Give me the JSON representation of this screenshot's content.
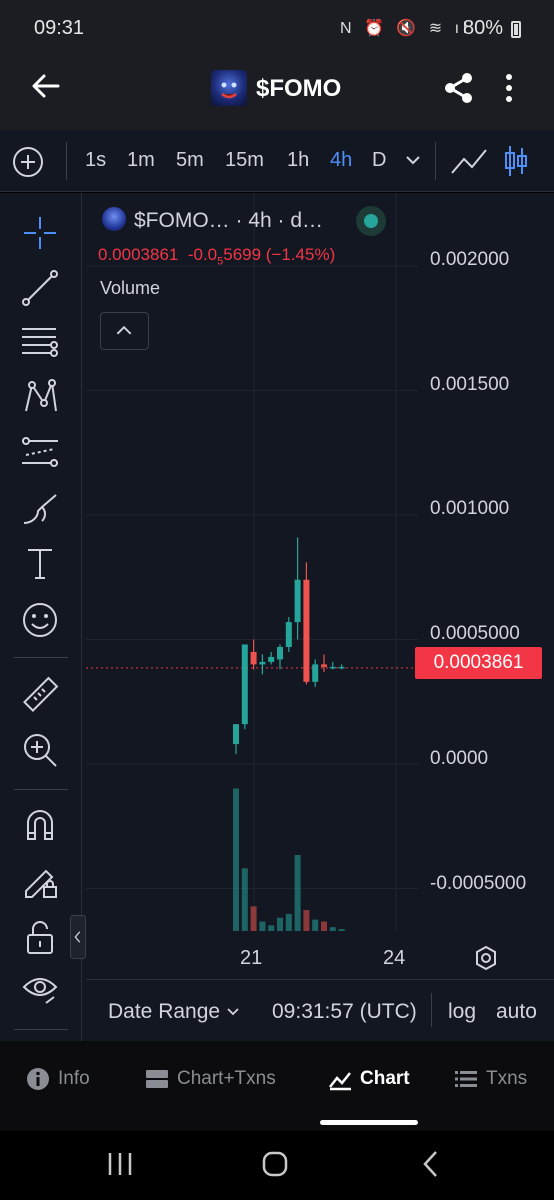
{
  "status_bar": {
    "time": "09:31",
    "icons": "N ⏰ 🔇 ≋ ıl",
    "battery": "80%"
  },
  "header": {
    "title": "$FOMO",
    "back_icon": "arrow-left-icon",
    "share_icon": "share-icon",
    "menu_icon": "more-vertical-icon"
  },
  "timeframes": {
    "items": [
      "1s",
      "1m",
      "5m",
      "15m",
      "1h",
      "4h",
      "D"
    ],
    "active": "4h"
  },
  "left_toolbar": {
    "tools": [
      "crosshair-icon",
      "trend-line-icon",
      "fib-retracement-icon",
      "pattern-icon",
      "prediction-icon",
      "brush-icon",
      "text-icon",
      "emoji-icon",
      "ruler-icon",
      "zoom-in-icon",
      "magnet-icon",
      "lock-drawing-icon",
      "unlock-icon",
      "eye-icon"
    ]
  },
  "legend": {
    "title": "$FOMO… · 4h · d…",
    "last": "0.0003861",
    "change_prefix": "-0.0",
    "change_sub": "5",
    "change_rest": "5699 (−1.45%)",
    "volume_label": "Volume"
  },
  "colors": {
    "up": "#26a69a",
    "down": "#ef5350",
    "accent": "#4e8ff8",
    "last_price_bg": "#f23645"
  },
  "chart_data": {
    "type": "candlestick",
    "price_axis_ticks": [
      "0.002000",
      "0.001500",
      "0.001000",
      "0.0005000",
      "0.0000",
      "-0.0005000"
    ],
    "x_tick_labels": [
      "21",
      "24"
    ],
    "last_price": "0.0003861",
    "ylim": [
      -0.0005,
      0.002
    ],
    "candles": [
      {
        "o": 8e-05,
        "h": 0.00016,
        "l": 4e-05,
        "c": 0.00016,
        "v": 0.75
      },
      {
        "o": 0.00016,
        "h": 0.00048,
        "l": 0.00014,
        "c": 0.00048,
        "v": 0.33
      },
      {
        "o": 0.00045,
        "h": 0.0005,
        "l": 0.00038,
        "c": 0.0004,
        "v": 0.13
      },
      {
        "o": 0.0004,
        "h": 0.00044,
        "l": 0.00036,
        "c": 0.00041,
        "v": 0.05
      },
      {
        "o": 0.00041,
        "h": 0.00045,
        "l": 0.0004,
        "c": 0.00043,
        "v": 0.03
      },
      {
        "o": 0.00042,
        "h": 0.00048,
        "l": 0.00038,
        "c": 0.00047,
        "v": 0.07
      },
      {
        "o": 0.00047,
        "h": 0.00059,
        "l": 0.00045,
        "c": 0.00057,
        "v": 0.09
      },
      {
        "o": 0.00057,
        "h": 0.00091,
        "l": 0.0005,
        "c": 0.00074,
        "v": 0.4
      },
      {
        "o": 0.00074,
        "h": 0.00081,
        "l": 0.00032,
        "c": 0.00033,
        "v": 0.11
      },
      {
        "o": 0.00033,
        "h": 0.00042,
        "l": 0.00031,
        "c": 0.0004,
        "v": 0.06
      },
      {
        "o": 0.0004,
        "h": 0.00044,
        "l": 0.00037,
        "c": 0.00039,
        "v": 0.05
      },
      {
        "o": 0.00039,
        "h": 0.00041,
        "l": 0.00038,
        "c": 0.00039,
        "v": 0.02
      },
      {
        "o": 0.00039,
        "h": 0.0004,
        "l": 0.00038,
        "c": 0.00039,
        "v": 0.01
      }
    ]
  },
  "chart_footer": {
    "date_range": "Date Range",
    "clock": "09:31:57 (UTC)",
    "log": "log",
    "auto": "auto"
  },
  "bottom_tabs": [
    {
      "label": "Info",
      "icon": "info-icon"
    },
    {
      "label": "Chart+Txns",
      "icon": "chart-txns-icon"
    },
    {
      "label": "Chart",
      "icon": "chart-area-icon"
    },
    {
      "label": "Txns",
      "icon": "list-icon"
    }
  ],
  "bottom_tabs_active": "Chart"
}
